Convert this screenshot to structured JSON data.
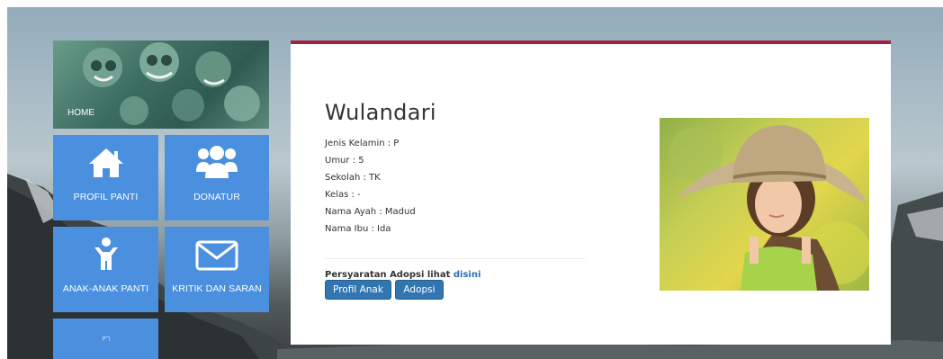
{
  "nav": {
    "home_label": "HOME",
    "tiles": [
      {
        "label": "PROFIL PANTI",
        "icon": "home-icon"
      },
      {
        "label": "DONATUR",
        "icon": "group-icon"
      },
      {
        "label": "ANAK-ANAK PANTI",
        "icon": "child-icon"
      },
      {
        "label": "KRITIK DAN SARAN",
        "icon": "envelope-icon"
      },
      {
        "label": "",
        "icon": "image-icon"
      }
    ]
  },
  "profile": {
    "name": "Wulandari",
    "fields": [
      "Jenis Kelamin : P",
      "Umur : 5",
      "Sekolah : TK",
      "Kelas : -",
      "Nama Ayah : Madud",
      "Nama Ibu : Ida"
    ],
    "requirement_text": "Persyaratan Adopsi lihat",
    "requirement_link": "disini",
    "buttons": {
      "profile": "Profil Anak",
      "adopt": "Adopsi"
    },
    "photo_icon": "child-photo"
  },
  "colors": {
    "tile_blue": "#4b8fdf",
    "accent_red": "#a3223f",
    "button_blue": "#3276b1",
    "link_blue": "#2a6ebb"
  }
}
